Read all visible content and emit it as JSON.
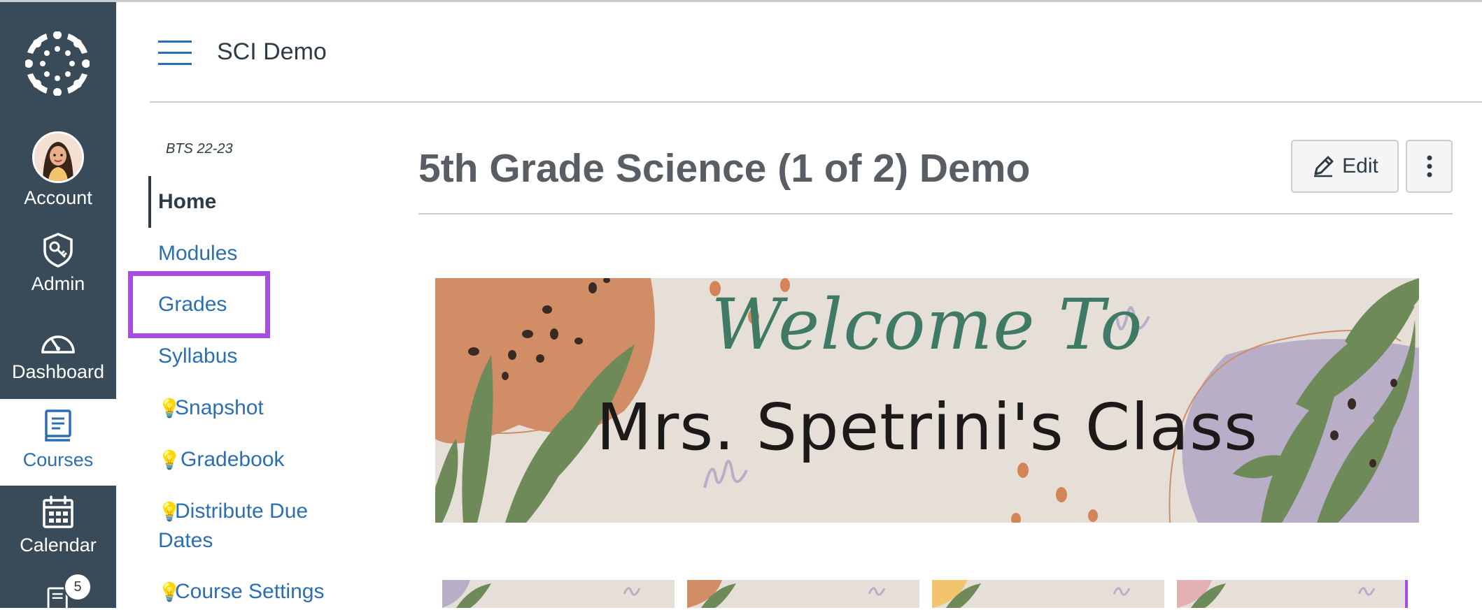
{
  "global_nav": {
    "items": [
      {
        "label": "Account",
        "icon": "avatar"
      },
      {
        "label": "Admin",
        "icon": "shield-key-icon"
      },
      {
        "label": "Dashboard",
        "icon": "dashboard-gauge-icon"
      },
      {
        "label": "Courses",
        "icon": "book-icon",
        "active": true
      },
      {
        "label": "Calendar",
        "icon": "calendar-icon"
      },
      {
        "label": "",
        "icon": "inbox-icon",
        "badge": "5"
      }
    ]
  },
  "header": {
    "course_title": "SCI Demo"
  },
  "course_nav": {
    "term": "BTS 22-23",
    "items": [
      {
        "label": "Home",
        "active": true
      },
      {
        "label": "Modules"
      },
      {
        "label": "Grades",
        "highlighted": true
      },
      {
        "label": "Syllabus"
      },
      {
        "label": "Snapshot",
        "icon": "lightbulb-icon"
      },
      {
        "label": "Gradebook",
        "icon": "lightbulb-icon"
      },
      {
        "label": "Distribute Due Dates",
        "icon": "lightbulb-icon"
      },
      {
        "label": "Course Settings",
        "icon": "lightbulb-icon"
      }
    ]
  },
  "main": {
    "page_title": "5th Grade Science (1 of 2) Demo",
    "edit_label": "Edit",
    "banner": {
      "script_text": "Welcome To",
      "main_text": "Mrs. Spetrini's Class"
    }
  },
  "colors": {
    "nav_bg": "#394b58",
    "link": "#2b6fb2",
    "highlight": "#a64de3"
  }
}
